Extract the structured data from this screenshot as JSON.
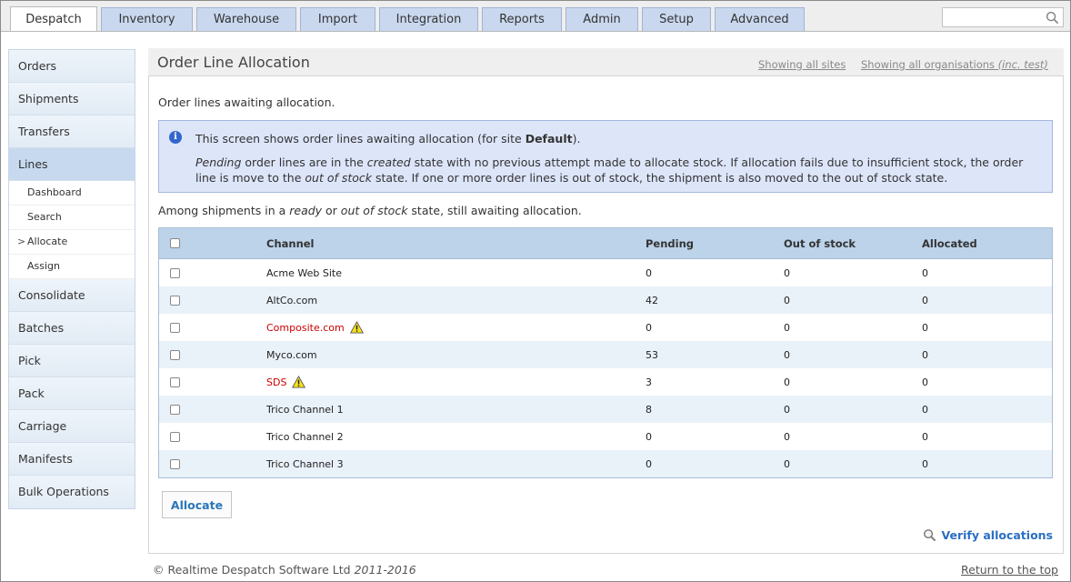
{
  "tabs": [
    {
      "label": "Despatch",
      "active": true
    },
    {
      "label": "Inventory"
    },
    {
      "label": "Warehouse"
    },
    {
      "label": "Import"
    },
    {
      "label": "Integration"
    },
    {
      "label": "Reports"
    },
    {
      "label": "Admin"
    },
    {
      "label": "Setup"
    },
    {
      "label": "Advanced"
    }
  ],
  "search": {
    "value": "",
    "icon": "search-icon"
  },
  "sidebar": {
    "items": [
      {
        "label": "Orders"
      },
      {
        "label": "Shipments"
      },
      {
        "label": "Transfers"
      },
      {
        "label": "Lines",
        "active": true
      },
      {
        "label": "Consolidate"
      },
      {
        "label": "Batches"
      },
      {
        "label": "Pick"
      },
      {
        "label": "Pack"
      },
      {
        "label": "Carriage"
      },
      {
        "label": "Manifests"
      },
      {
        "label": "Bulk Operations"
      }
    ],
    "sub_items": [
      {
        "label": "Dashboard"
      },
      {
        "label": "Search"
      },
      {
        "label": "Allocate",
        "current": true
      },
      {
        "label": "Assign"
      }
    ]
  },
  "header": {
    "title": "Order Line Allocation",
    "link_sites": "Showing all sites",
    "link_orgs": "Showing all organisations",
    "link_orgs_suffix": "(inc. test)"
  },
  "main": {
    "intro": "Order lines awaiting allocation.",
    "info_line1_prefix": "This screen shows order lines awaiting allocation (for site ",
    "info_site": "Default",
    "info_line1_suffix": ").",
    "info_p2_a": "Pending",
    "info_p2_b": " order lines are in the ",
    "info_p2_c": "created",
    "info_p2_d": " state with no previous attempt made to allocate stock. If allocation fails due to insufficient stock, the order line is move to the ",
    "info_p2_e": "out of stock",
    "info_p2_f": " state. If one or more order lines is out of stock, the shipment is also moved to the out of stock state.",
    "among_a": "Among shipments in a ",
    "among_b": "ready",
    "among_c": " or ",
    "among_d": "out of stock",
    "among_e": " state, still awaiting allocation."
  },
  "table": {
    "headers": {
      "channel": "Channel",
      "pending": "Pending",
      "out_of_stock": "Out of stock",
      "allocated": "Allocated"
    },
    "rows": [
      {
        "channel": "Acme Web Site",
        "pending": "0",
        "out_of_stock": "0",
        "allocated": "0",
        "warning": false
      },
      {
        "channel": "AltCo.com",
        "pending": "42",
        "out_of_stock": "0",
        "allocated": "0",
        "warning": false
      },
      {
        "channel": "Composite.com",
        "pending": "0",
        "out_of_stock": "0",
        "allocated": "0",
        "warning": true
      },
      {
        "channel": "Myco.com",
        "pending": "53",
        "out_of_stock": "0",
        "allocated": "0",
        "warning": false
      },
      {
        "channel": "SDS",
        "pending": "3",
        "out_of_stock": "0",
        "allocated": "0",
        "warning": true
      },
      {
        "channel": "Trico Channel 1",
        "pending": "8",
        "out_of_stock": "0",
        "allocated": "0",
        "warning": false
      },
      {
        "channel": "Trico Channel 2",
        "pending": "0",
        "out_of_stock": "0",
        "allocated": "0",
        "warning": false
      },
      {
        "channel": "Trico Channel 3",
        "pending": "0",
        "out_of_stock": "0",
        "allocated": "0",
        "warning": false
      }
    ]
  },
  "actions": {
    "allocate_label": "Allocate",
    "verify_label": "Verify allocations"
  },
  "footer": {
    "copyright": "© Realtime Despatch Software Ltd",
    "years": "2011-2016",
    "top_link": "Return to the top"
  },
  "colors": {
    "accent": "#2a76b8",
    "warning_channel": "#cc0000",
    "tab_bg": "#c9d8ee",
    "header_row": "#bcd3ea"
  }
}
